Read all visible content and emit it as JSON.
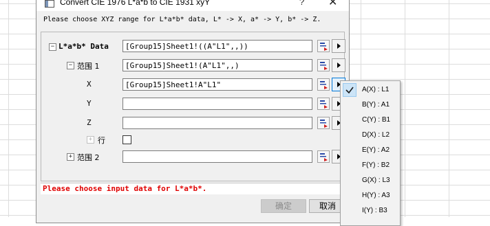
{
  "dialog": {
    "title": "Convert CIE 1976 L*a*b to CIE 1931 xyY",
    "help_label": "?",
    "close_label": "✕",
    "description": "Please choose XYZ range for L*a*b* data, L* -> X, a* -> Y, b* -> Z."
  },
  "tree": {
    "lab_data": {
      "expander": "−",
      "label": "L*a*b* Data",
      "value": "[Group15]Sheet1!((A\"L1\",,))"
    },
    "range1": {
      "expander": "−",
      "label": "范围 1",
      "value": "[Group15]Sheet1!(A\"L1\",,)"
    },
    "x": {
      "label": "X",
      "value": "[Group15]Sheet1!A\"L1\""
    },
    "y": {
      "label": "Y",
      "value": ""
    },
    "z": {
      "label": "Z",
      "value": ""
    },
    "row": {
      "expander": "+",
      "label": "行",
      "checked": false
    },
    "range2": {
      "expander": "+",
      "label": "范围 2",
      "value": ""
    }
  },
  "error_message": "Please choose input data for L*a*b*.",
  "buttons": {
    "ok_label": "确定",
    "cancel_label": "取消"
  },
  "column_menu": {
    "items": [
      {
        "label": "A(X) : L1",
        "checked": true
      },
      {
        "label": "B(Y) : A1",
        "checked": false
      },
      {
        "label": "C(Y) : B1",
        "checked": false
      },
      {
        "label": "D(X) : L2",
        "checked": false
      },
      {
        "label": "E(Y) : A2",
        "checked": false
      },
      {
        "label": "F(Y) : B2",
        "checked": false
      },
      {
        "label": "G(X) : L3",
        "checked": false
      },
      {
        "label": "H(Y) : A3",
        "checked": false
      },
      {
        "label": "I(Y) : B3",
        "checked": false
      }
    ]
  },
  "colors": {
    "error": "#e00000",
    "check_highlight": "#cce4f7",
    "accent": "#0078d7"
  }
}
